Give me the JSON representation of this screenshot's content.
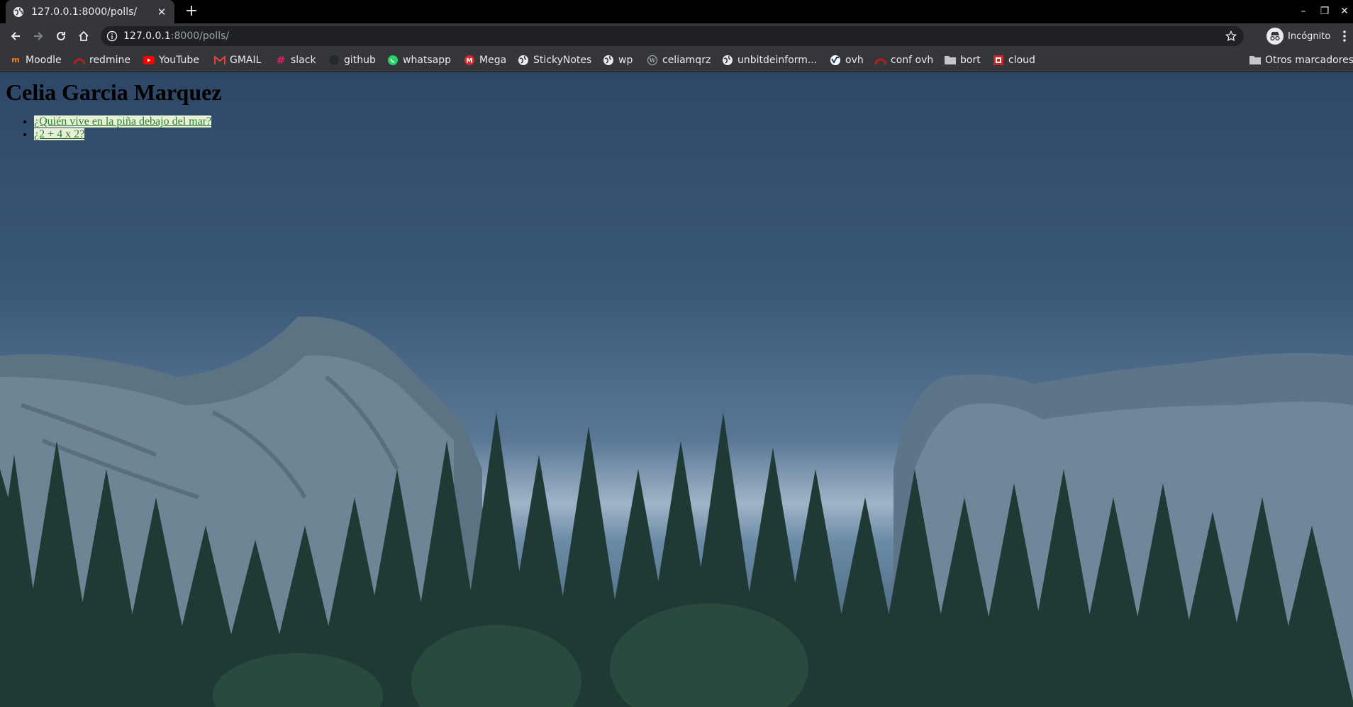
{
  "browser": {
    "tab_title": "127.0.0.1:8000/polls/",
    "new_tab_symbol": "+",
    "address_host": "127.0.0.1",
    "address_path": ":8000/polls/",
    "profile_label": "Incógnito",
    "bookmarks": [
      {
        "label": "Moodle",
        "icon": "moodle-icon"
      },
      {
        "label": "redmine",
        "icon": "redmine-icon"
      },
      {
        "label": "YouTube",
        "icon": "youtube-icon"
      },
      {
        "label": "GMAIL",
        "icon": "gmail-icon"
      },
      {
        "label": "slack",
        "icon": "slack-icon"
      },
      {
        "label": "github",
        "icon": "github-icon"
      },
      {
        "label": "whatsapp",
        "icon": "whatsapp-icon"
      },
      {
        "label": "Mega",
        "icon": "mega-icon"
      },
      {
        "label": "StickyNotes",
        "icon": "globe-icon"
      },
      {
        "label": "wp",
        "icon": "globe-icon"
      },
      {
        "label": "celiamqrz",
        "icon": "wordpress-icon"
      },
      {
        "label": "unbitdeinform...",
        "icon": "globe-icon"
      },
      {
        "label": "ovh",
        "icon": "ovh-icon"
      },
      {
        "label": "conf ovh",
        "icon": "redmine-icon"
      },
      {
        "label": "bort",
        "icon": "folder-icon"
      },
      {
        "label": "cloud",
        "icon": "cloud-icon"
      }
    ],
    "other_bookmarks": "Otros marcadores"
  },
  "page": {
    "heading": "Celia Garcia Marquez",
    "polls": [
      {
        "question": "¿Quién vive en la piña debajo del mar?"
      },
      {
        "question": "¿2 + 4 x 2?"
      }
    ]
  }
}
